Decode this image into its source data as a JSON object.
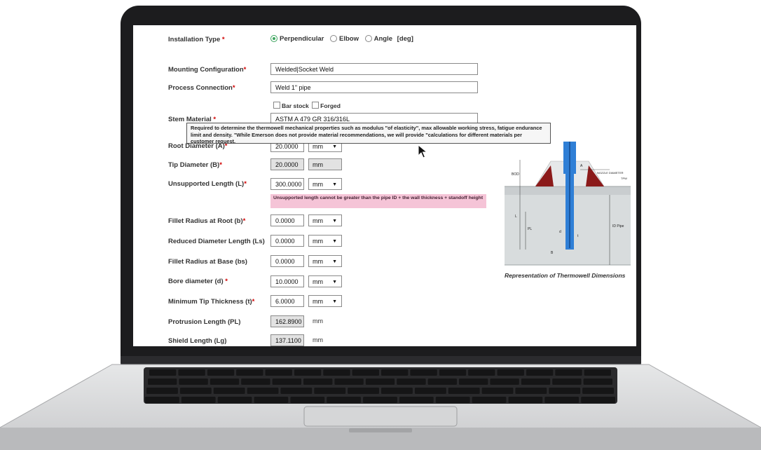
{
  "form": {
    "installation_type": {
      "label": "Installation Type",
      "required": "*",
      "options": [
        "Perpendicular",
        "Elbow",
        "Angle"
      ],
      "selected": "Perpendicular",
      "angle_unit": "[deg]"
    },
    "mounting_configuration": {
      "label": "Mounting Configuration",
      "required": "*",
      "value": "Welded|Socket Weld"
    },
    "process_connection": {
      "label": "Process Connection",
      "required": "*",
      "value": "Weld 1\" pipe"
    },
    "stem_options": [
      "Bar stock",
      "Forged"
    ],
    "stem_material": {
      "label": "Stem Material",
      "required": "*",
      "value": "ASTM A 479 GR 316/316L"
    },
    "tooltip": "Required to determine the thermowell mechanical properties such as modulus \"of elasticity\", max allowable working stress, fatigue endurance limit and density. \"While Emerson does not provide material recommendations, we will provide \"calculations for different materials per customer request.",
    "root_diameter": {
      "label": "Root Diameter (A)",
      "required": "*",
      "value": "20.0000",
      "unit": "mm"
    },
    "tip_diameter": {
      "label": "Tip Diameter (B)",
      "required": "*",
      "value": "20.0000",
      "unit": "mm"
    },
    "unsupported_length": {
      "label": "Unsupported Length (L)",
      "required": "*",
      "value": "300.0000",
      "unit": "mm"
    },
    "warning": "Unsupported length cannot be greater than the pipe ID + the wall thickness + standoff height",
    "fillet_root": {
      "label": "Fillet Radius at Root (b)",
      "required": "*",
      "value": "0.0000",
      "unit": "mm"
    },
    "reduced_diameter_length": {
      "label": "Reduced Diameter Length (Ls)",
      "value": "0.0000",
      "unit": "mm"
    },
    "fillet_base": {
      "label": "Fillet Radius at Base (bs)",
      "value": "0.0000",
      "unit": "mm"
    },
    "bore_diameter": {
      "label": "Bore diameter (d)",
      "required": "*",
      "value": "10.0000",
      "unit": "mm"
    },
    "min_tip_thickness": {
      "label": "Minimum Tip Thickness (t)",
      "required": "*",
      "value": "6.0000",
      "unit": "mm"
    },
    "protrusion_length": {
      "label": "Protrusion Length (PL)",
      "value": "162.8900",
      "unit": "mm"
    },
    "shield_length": {
      "label": "Shield Length (Lg)",
      "value": "137.1100",
      "unit": "mm"
    }
  },
  "diagram": {
    "caption": "Representation of Thermowell Dimensions",
    "labels": {
      "nozzle": "NOZZLE DIAMETER",
      "tpw": "TPW",
      "bod": "BOD",
      "pl": "PL",
      "id_pipe": "ID Pipe",
      "a": "A",
      "b": "B",
      "l": "L",
      "d": "d",
      "t": "t"
    }
  },
  "colors": {
    "required": "#d00000",
    "thermowell": "#2f7fd6",
    "weld": "#8b1a1a",
    "warning_bg": "#f5c4d7",
    "radio_selected": "#3aa35c"
  },
  "icons": [
    "mouse-cursor-icon",
    "dropdown-caret-icon"
  ]
}
